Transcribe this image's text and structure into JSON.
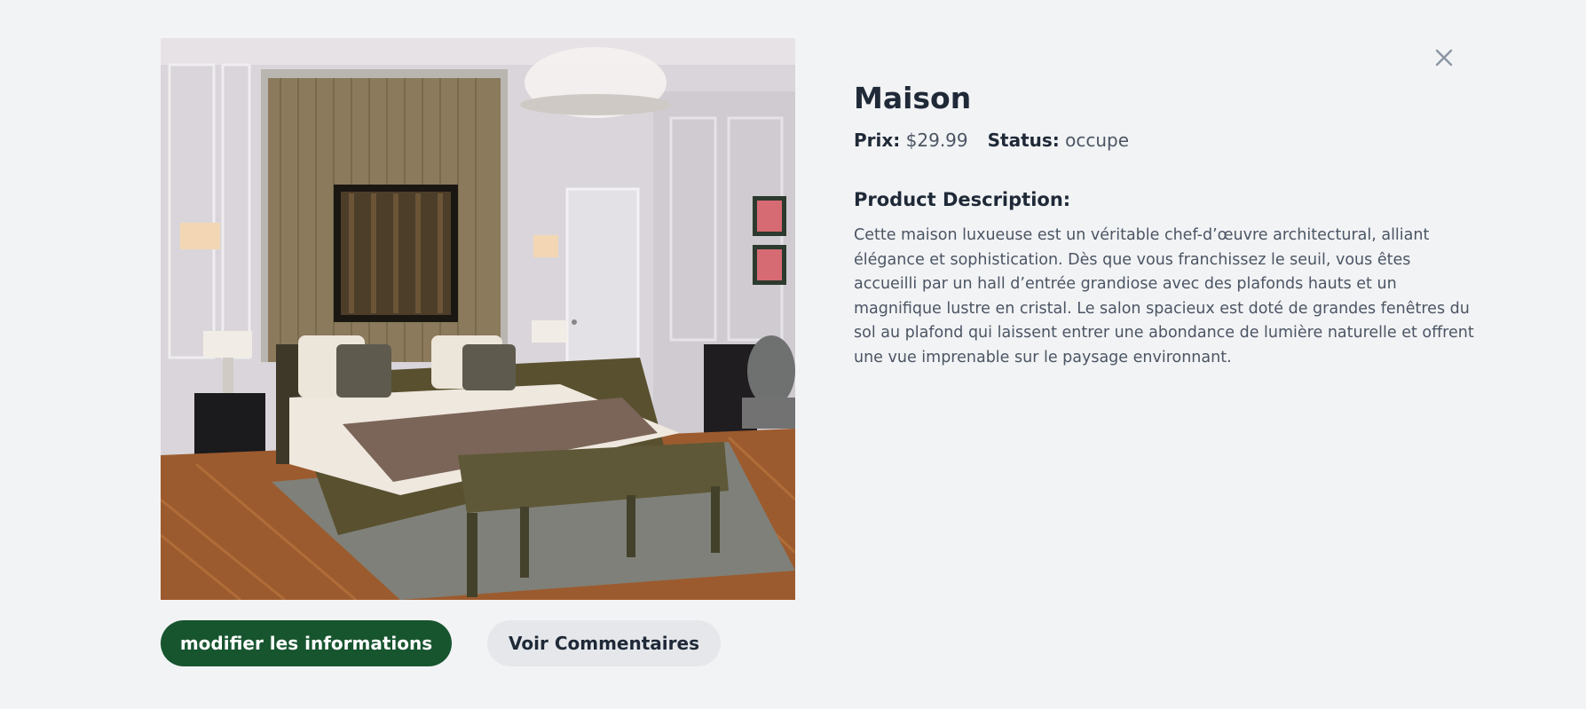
{
  "product": {
    "name": "Maison",
    "price_label": "Prix:",
    "price_value": "$29.99",
    "status_label": "Status:",
    "status_value": "occupe",
    "description_heading": "Product Description:",
    "description": "Cette maison luxueuse est un véritable chef-d’œuvre architectural, alliant élégance et sophistication. Dès que vous franchissez le seuil, vous êtes accueilli par un hall d’entrée grandiose avec des plafonds hauts et un magnifique lustre en cristal. Le salon spacieux est doté de grandes fenêtres du sol au plafond qui laissent entrer une abondance de lumière naturelle et offrent une vue imprenable sur le paysage environnant."
  },
  "actions": {
    "edit_label": "modifier les informations",
    "comments_label": "Voir Commentaires"
  },
  "icons": {
    "close": "close-icon"
  },
  "colors": {
    "background": "#f2f3f5",
    "primary_button": "#17552f",
    "secondary_button": "#e5e7eb",
    "heading_text": "#1f2937",
    "body_text": "#4b5563"
  }
}
